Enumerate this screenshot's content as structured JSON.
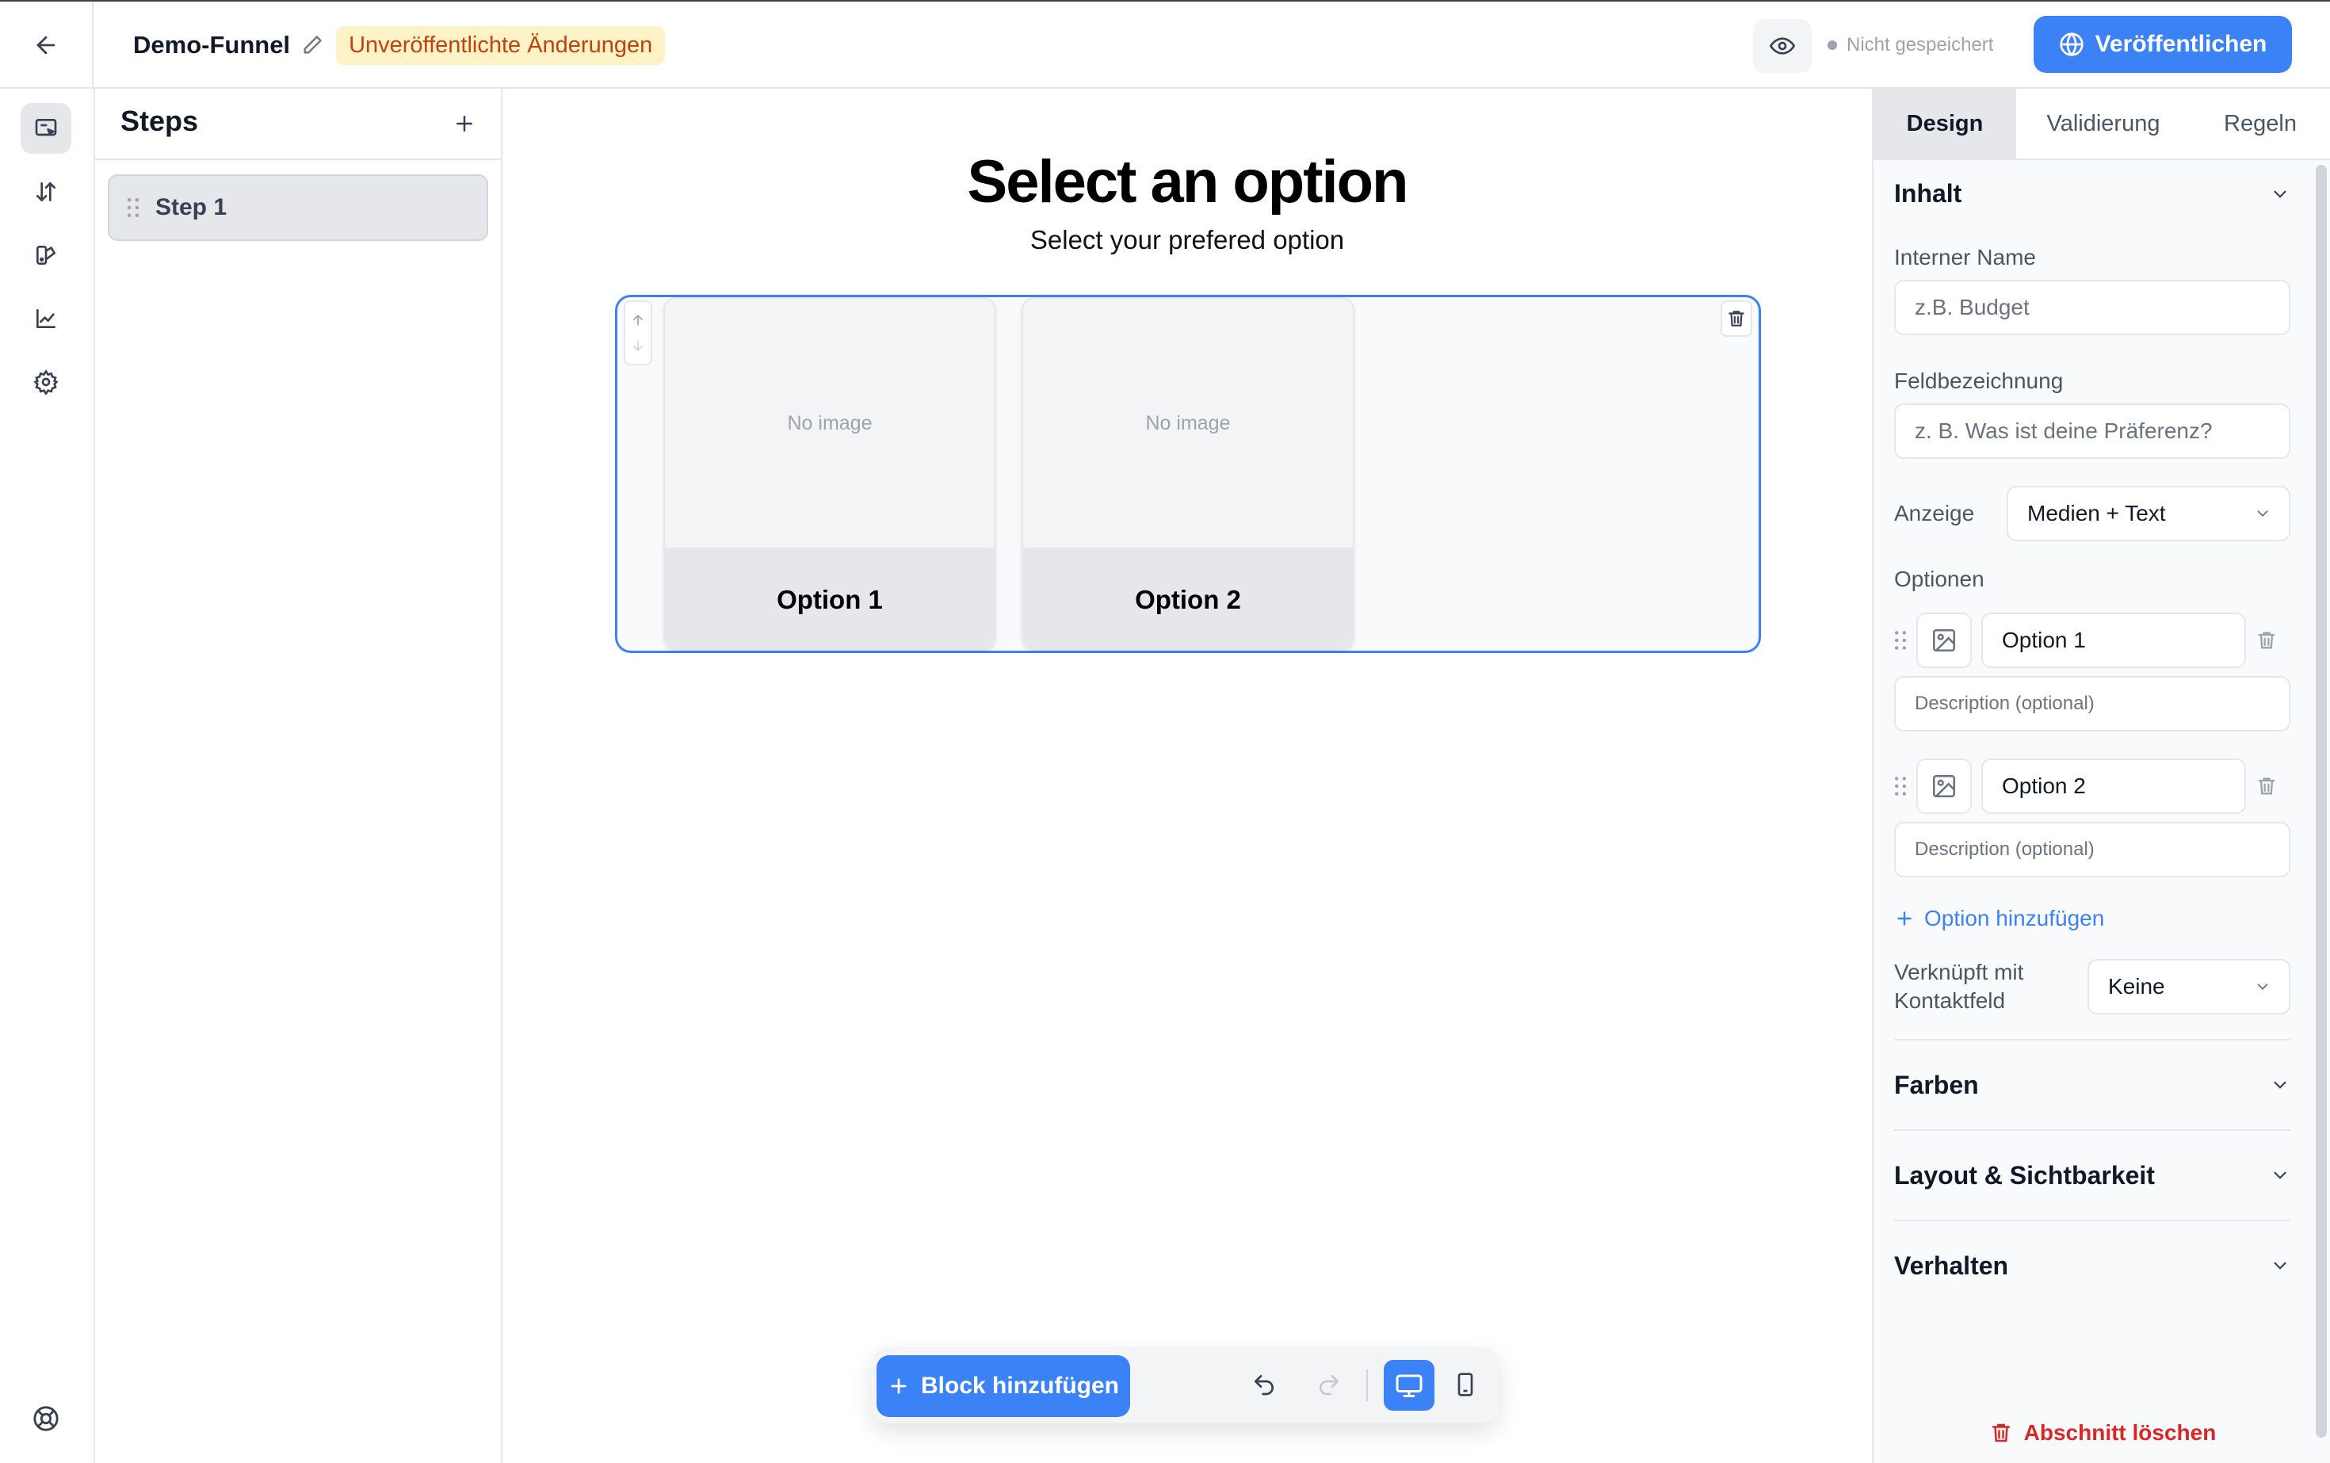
{
  "header": {
    "title": "Demo-Funnel",
    "badge": "Unveröffentlichte Änderungen",
    "save_status": "Nicht gespeichert",
    "publish_label": "Veröffentlichen"
  },
  "rail": {
    "icons": [
      "editor-icon",
      "swap-icon",
      "theme-icon",
      "analytics-icon",
      "settings-icon"
    ],
    "bottom_icon": "help-icon"
  },
  "steps": {
    "title": "Steps",
    "items": [
      {
        "label": "Step 1"
      }
    ]
  },
  "canvas": {
    "title": "Select an option",
    "subtitle": "Select your prefered option",
    "options": [
      {
        "label": "Option 1",
        "image_placeholder": "No image"
      },
      {
        "label": "Option 2",
        "image_placeholder": "No image"
      }
    ]
  },
  "toolbar": {
    "add_block_label": "Block hinzufügen"
  },
  "inspector": {
    "tabs": [
      "Design",
      "Validierung",
      "Regeln"
    ],
    "active_tab": "Design",
    "content_section": "Inhalt",
    "internal_name_label": "Interner Name",
    "internal_name_placeholder": "z.B. Budget",
    "field_label_label": "Feldbezeichnung",
    "field_label_placeholder": "z. B. Was ist deine Präferenz?",
    "display_label": "Anzeige",
    "display_value": "Medien + Text",
    "options_label": "Optionen",
    "option_rows": [
      {
        "value": "Option 1",
        "description_placeholder": "Description (optional)"
      },
      {
        "value": "Option 2",
        "description_placeholder": "Description (optional)"
      }
    ],
    "add_option_label": "Option hinzufügen",
    "linked_label_line1": "Verknüpft mit",
    "linked_label_line2": "Kontaktfeld",
    "linked_value": "Keine",
    "collapsed_sections": [
      "Farben",
      "Layout & Sichtbarkeit",
      "Verhalten"
    ],
    "delete_label": "Abschnitt löschen"
  },
  "colors": {
    "accent": "#3b82f6",
    "badge_bg": "#fef3c7",
    "badge_text": "#c2410c",
    "danger": "#dc2626"
  }
}
